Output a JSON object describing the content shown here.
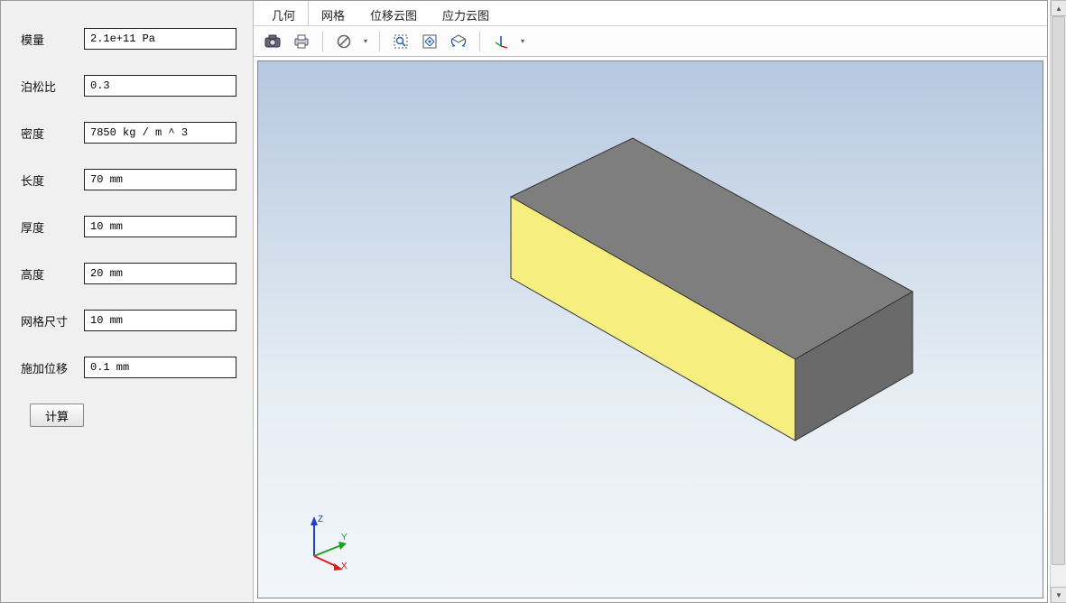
{
  "form": {
    "fields": [
      {
        "label": "模量",
        "value": "2.1e+11 Pa"
      },
      {
        "label": "泊松比",
        "value": "0.3"
      },
      {
        "label": "密度",
        "value": "7850 kg / m ^ 3"
      },
      {
        "label": "长度",
        "value": "70 mm"
      },
      {
        "label": "厚度",
        "value": "10 mm"
      },
      {
        "label": "高度",
        "value": "20 mm"
      },
      {
        "label": "网格尺寸",
        "value": "10 mm"
      },
      {
        "label": "施加位移",
        "value": "0.1 mm"
      }
    ],
    "calc_label": "计算"
  },
  "tabs": {
    "items": [
      "几何",
      "网格",
      "位移云图",
      "应力云图"
    ],
    "active": 0
  },
  "toolbar": {
    "camera": "camera-icon",
    "print": "print-icon",
    "forbid": "forbid-icon",
    "zoom": "zoom-box-icon",
    "fit": "fit-view-icon",
    "rotate": "rotate-icon",
    "axes": "axes-icon"
  },
  "triad": {
    "x": "X",
    "y": "Y",
    "z": "Z",
    "colors": {
      "x": "#d02020",
      "y": "#20a020",
      "z": "#2040d0"
    }
  }
}
